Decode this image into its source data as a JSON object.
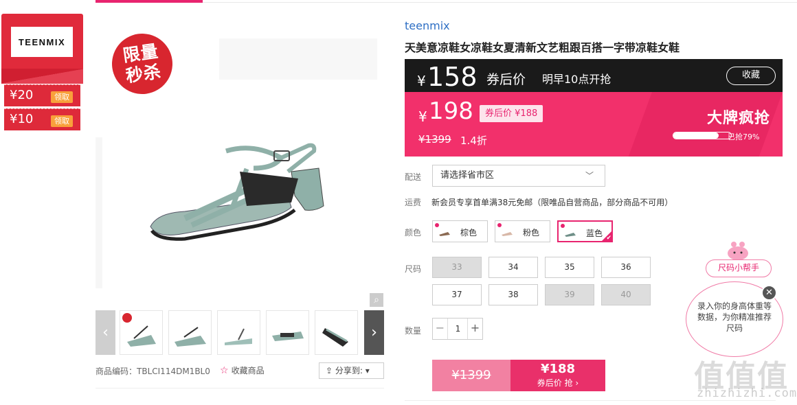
{
  "coupons": {
    "brand_logo": "TEENMIX",
    "items": [
      {
        "amount": "¥20",
        "action": "领取"
      },
      {
        "amount": "¥10",
        "action": "领取"
      }
    ]
  },
  "gallery": {
    "flash_badge": "限量\n秒杀",
    "product_code_label": "商品编码：",
    "product_code": "TBLCI114DM1BL0",
    "favorite_product": "收藏商品",
    "share": "分享到:"
  },
  "product": {
    "brand": "teenmix",
    "title": "天美意凉鞋女凉鞋女夏清新文艺粗跟百搭一字带凉鞋女鞋"
  },
  "price_banner": {
    "currency": "¥",
    "coupon_price": "158",
    "after_coupon_label": "券后价",
    "start_time": "明早10点开抢",
    "favorite": "收藏",
    "sale_price": "198",
    "coupon_tag_label": "券后价",
    "coupon_tag_price": "¥188",
    "original_price": "¥1399",
    "discount": "1.4折",
    "big_grab": "大牌疯抢",
    "progress_percent": 79,
    "progress_text": "已抢79%"
  },
  "delivery": {
    "label": "配送",
    "select_value": "请选择省市区",
    "shipping_label": "运费",
    "shipping_text": "新会员专享首单满38元免邮（限唯品自营商品，部分商品不可用）"
  },
  "colors": {
    "label": "颜色",
    "options": [
      {
        "name": "棕色",
        "selected": false
      },
      {
        "name": "粉色",
        "selected": false
      },
      {
        "name": "蓝色",
        "selected": true
      }
    ]
  },
  "sizes": {
    "label": "尺码",
    "options": [
      {
        "size": "33",
        "available": false
      },
      {
        "size": "34",
        "available": true
      },
      {
        "size": "35",
        "available": true
      },
      {
        "size": "36",
        "available": true
      },
      {
        "size": "37",
        "available": true
      },
      {
        "size": "38",
        "available": true
      },
      {
        "size": "39",
        "available": false
      },
      {
        "size": "40",
        "available": false
      }
    ]
  },
  "quantity": {
    "label": "数量",
    "minus": "−",
    "value": "1",
    "plus": "+"
  },
  "buy": {
    "original_price": "¥1399",
    "price": "¥188",
    "action": "券后价 抢 ›"
  },
  "size_helper": {
    "title": "尺码小帮手",
    "text": "录入你的身高体重等数据，为你精准推荐尺码",
    "close": "✕"
  },
  "watermark": {
    "text": "值值值",
    "url": "zhizhizhi.com"
  },
  "colors_theme": {
    "accent": "#e8246f",
    "coupon_red": "#de2a3a",
    "dark_banner": "#1a1a1a",
    "pink_banner": "#f2306b"
  }
}
